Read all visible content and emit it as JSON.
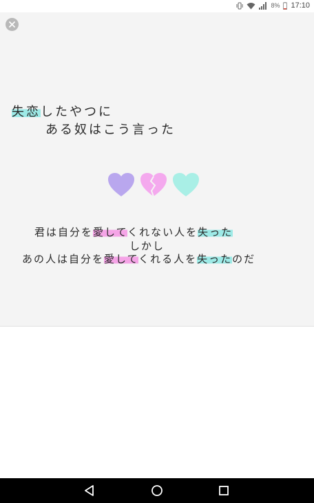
{
  "status_bar": {
    "battery_percent": "8%",
    "time": "17:10",
    "icons": [
      "vibrate-icon",
      "wifi-icon",
      "signal-icon",
      "battery-icon"
    ]
  },
  "image": {
    "close_icon": "close-icon",
    "title": {
      "line1_highlight": "失恋",
      "line1_rest": "したやつに",
      "line2": "ある奴はこう言った"
    },
    "hearts": [
      {
        "name": "purple-heart",
        "color": "#b9a7ee"
      },
      {
        "name": "broken-pink-heart",
        "color": "#f4a9ee"
      },
      {
        "name": "cyan-heart",
        "color": "#a9efe6"
      }
    ],
    "quote": {
      "line1": {
        "p1": "君は自分を",
        "h1": "愛して",
        "p2": "くれない人を",
        "h2": "失った"
      },
      "line2": "しかし",
      "line3": {
        "p1": "あの人は自分を",
        "h1": "愛して",
        "p2": "くれる人を",
        "h2": "失った",
        "p3": "のだ"
      }
    },
    "highlight_colors": {
      "cyan": "#78e6e1",
      "pink": "#f582e1"
    }
  },
  "nav_bar": {
    "icons": [
      "back-icon",
      "home-icon",
      "recents-icon"
    ]
  }
}
